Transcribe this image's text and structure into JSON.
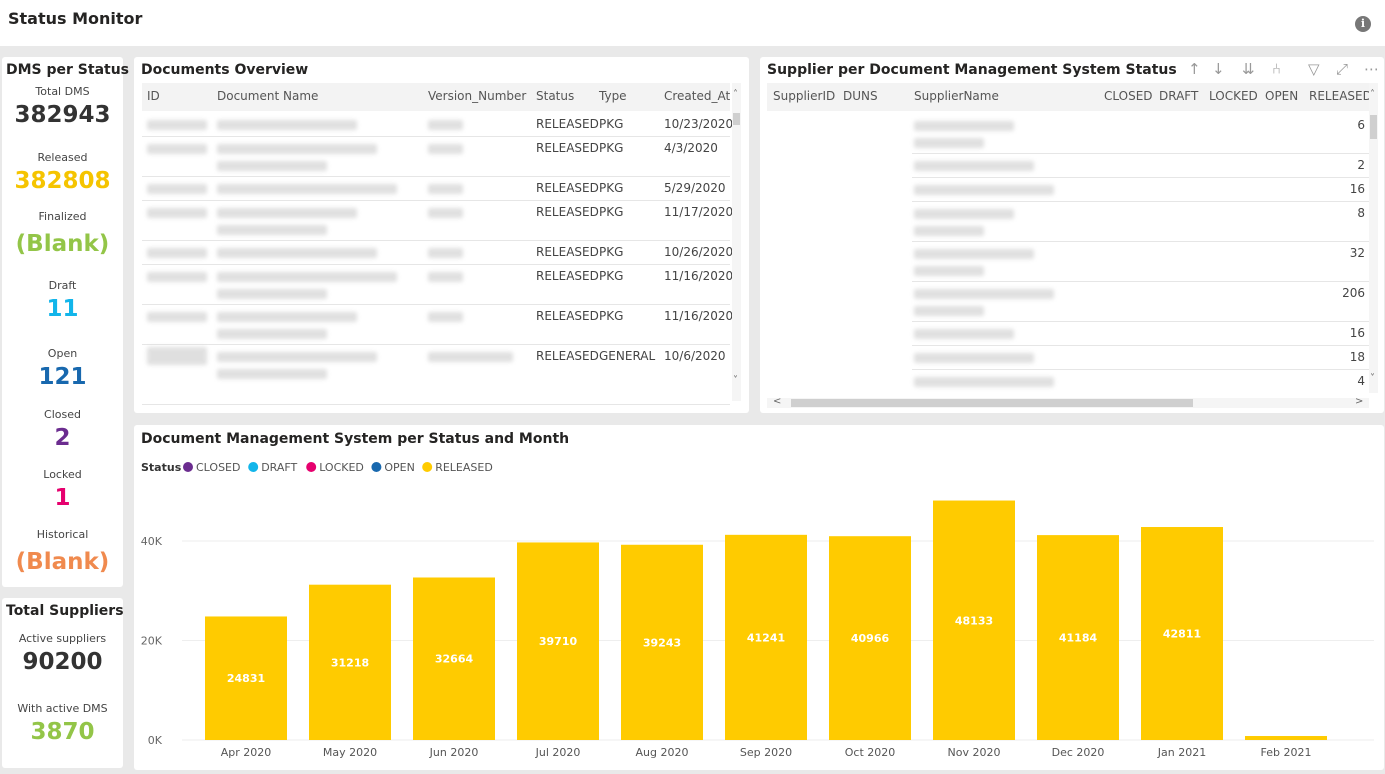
{
  "header": {
    "title": "Status Monitor",
    "info_icon": "info-icon"
  },
  "dms": {
    "title": "DMS per Status",
    "kpis": [
      {
        "label": "Total DMS",
        "value": "382943",
        "color": "#333333"
      },
      {
        "label": "Released",
        "value": "382808",
        "color": "#F5C400"
      },
      {
        "label": "Finalized",
        "value": "(Blank)",
        "color": "#93C548"
      },
      {
        "label": "Draft",
        "value": "11",
        "color": "#12B5EA"
      },
      {
        "label": "Open",
        "value": "121",
        "color": "#1868AE"
      },
      {
        "label": "Closed",
        "value": "2",
        "color": "#6B2C8F"
      },
      {
        "label": "Locked",
        "value": "1",
        "color": "#E6006E"
      },
      {
        "label": "Historical",
        "value": "(Blank)",
        "color": "#F08A4E"
      }
    ]
  },
  "suppliers": {
    "title": "Total Suppliers",
    "kpis": [
      {
        "label": "Active suppliers",
        "value": "90200",
        "color": "#333333"
      },
      {
        "label": "With active DMS",
        "value": "3870",
        "color": "#93C548"
      }
    ]
  },
  "documents": {
    "title": "Documents Overview",
    "columns": [
      "ID",
      "Document Name",
      "Version_Number",
      "Status",
      "Type",
      "Created_At"
    ],
    "rows": [
      {
        "status": "RELEASED",
        "type": "PKG",
        "created": "10/23/2020"
      },
      {
        "status": "RELEASED",
        "type": "PKG",
        "created": "4/3/2020"
      },
      {
        "status": "RELEASED",
        "type": "PKG",
        "created": "5/29/2020"
      },
      {
        "status": "RELEASED",
        "type": "PKG",
        "created": "11/17/2020"
      },
      {
        "status": "RELEASED",
        "type": "PKG",
        "created": "10/26/2020"
      },
      {
        "status": "RELEASED",
        "type": "PKG",
        "created": "11/16/2020"
      },
      {
        "status": "RELEASED",
        "type": "PKG",
        "created": "11/16/2020"
      },
      {
        "status": "RELEASED",
        "type": "GENERAL",
        "created": "10/6/2020"
      }
    ]
  },
  "supplier_table": {
    "title": "Supplier per Document Management System Status",
    "columns": [
      "SupplierID",
      "DUNS",
      "SupplierName",
      "CLOSED",
      "DRAFT",
      "LOCKED",
      "OPEN",
      "RELEASED"
    ],
    "rows": [
      {
        "released": "6"
      },
      {
        "released": "2"
      },
      {
        "released": "16"
      },
      {
        "released": "8"
      },
      {
        "released": "32"
      },
      {
        "released": "206"
      },
      {
        "released": "16"
      },
      {
        "released": "18"
      },
      {
        "released": "4"
      }
    ],
    "toolbar_icons": [
      "sort-ascending-icon",
      "sort-descending-icon",
      "expand-all-icon",
      "drill-down-icon",
      "filter-icon",
      "focus-mode-icon",
      "more-options-icon"
    ]
  },
  "chart_data": {
    "type": "bar",
    "title": "Document Management System per Status and Month",
    "legend": {
      "title": "Status",
      "placement": "top-left",
      "entries": [
        {
          "name": "CLOSED",
          "color": "#6B2C8F"
        },
        {
          "name": "DRAFT",
          "color": "#12B5EA"
        },
        {
          "name": "LOCKED",
          "color": "#E6006E"
        },
        {
          "name": "OPEN",
          "color": "#1868AE"
        },
        {
          "name": "RELEASED",
          "color": "#FFCB00"
        }
      ]
    },
    "categories": [
      "Apr 2020",
      "May 2020",
      "Jun 2020",
      "Jul 2020",
      "Aug 2020",
      "Sep 2020",
      "Oct 2020",
      "Nov 2020",
      "Dec 2020",
      "Jan 2021",
      "Feb 2021"
    ],
    "series": [
      {
        "name": "RELEASED",
        "color": "#FFCB00",
        "values": [
          24831,
          31218,
          32664,
          39710,
          39243,
          41241,
          40966,
          48133,
          41184,
          42811,
          800
        ],
        "labels": [
          "24831",
          "31218",
          "32664",
          "39710",
          "39243",
          "41241",
          "40966",
          "48133",
          "41184",
          "42811",
          ""
        ]
      }
    ],
    "yticks": [
      "0K",
      "20K",
      "40K"
    ],
    "ylim": [
      0,
      50000
    ],
    "grid": true
  }
}
